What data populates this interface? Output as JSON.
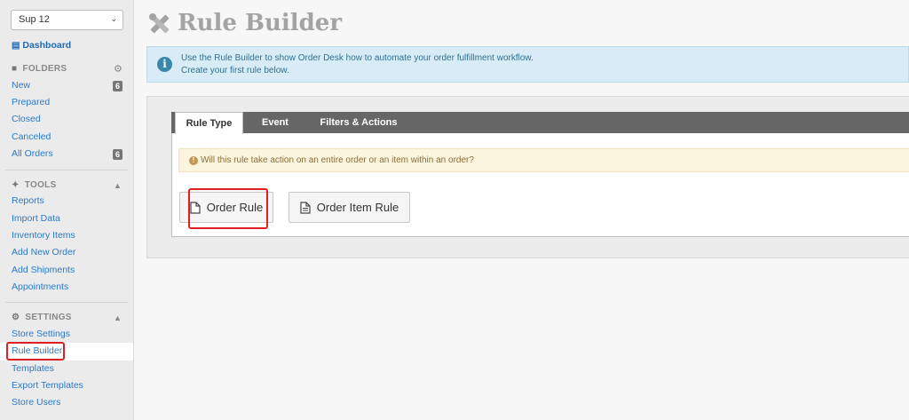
{
  "sidebar": {
    "store_select": "Sup 12",
    "dashboard": "Dashboard",
    "folders": {
      "heading": "FOLDERS",
      "items": [
        {
          "label": "New",
          "badge": "6"
        },
        {
          "label": "Prepared"
        },
        {
          "label": "Closed"
        },
        {
          "label": "Canceled"
        },
        {
          "label": "All Orders",
          "badge": "6"
        }
      ]
    },
    "tools": {
      "heading": "TOOLS",
      "items": [
        "Reports",
        "Import Data",
        "Inventory Items",
        "Add New Order",
        "Add Shipments",
        "Appointments"
      ]
    },
    "settings": {
      "heading": "SETTINGS",
      "items": [
        "Store Settings",
        "Rule Builder",
        "Templates",
        "Export Templates",
        "Store Users"
      ]
    },
    "active_item": "Rule Builder"
  },
  "page": {
    "title": "Rule Builder",
    "info_line1": "Use the Rule Builder to show Order Desk how to automate your order fulfillment workflow.",
    "info_line2": "Create your first rule below."
  },
  "tabs": [
    {
      "label": "Rule Type",
      "active": true
    },
    {
      "label": "Event",
      "active": false
    },
    {
      "label": "Filters & Actions",
      "active": false
    }
  ],
  "question": "Will this rule take action on an entire order or an item within an order?",
  "buttons": {
    "order_rule": "Order Rule",
    "order_item_rule": "Order Item Rule"
  },
  "colors": {
    "link": "#2a7ac8",
    "highlight": "#e02020",
    "info_bg": "#d7ecf6",
    "warning_bg": "#fcf5dd",
    "tabbar": "#666666"
  }
}
